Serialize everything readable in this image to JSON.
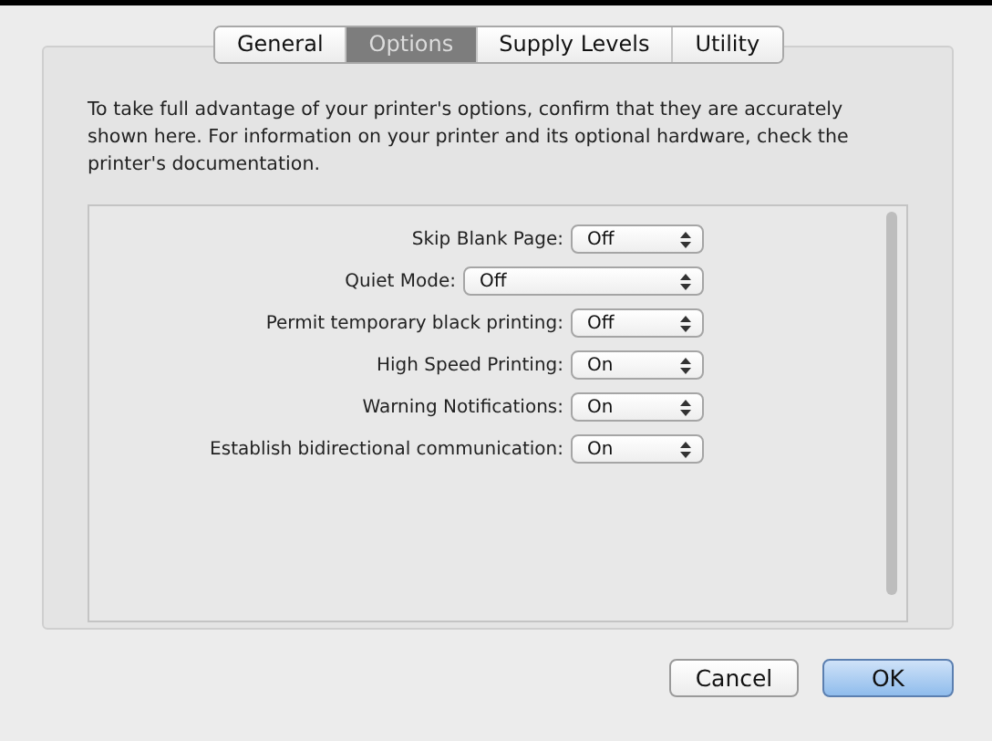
{
  "tabs": [
    {
      "label": "General",
      "selected": false
    },
    {
      "label": "Options",
      "selected": true
    },
    {
      "label": "Supply Levels",
      "selected": false
    },
    {
      "label": "Utility",
      "selected": false
    }
  ],
  "description": "To take full advantage of your printer's options, confirm that they are accurately shown here. For information on your printer and its optional hardware, check the printer's documentation.",
  "options": [
    {
      "label": "Skip Blank Page:",
      "value": "Off",
      "kind": "narrow"
    },
    {
      "label": "Quiet Mode:",
      "value": "Off",
      "kind": "wide"
    },
    {
      "label": "Permit temporary black printing:",
      "value": "Off",
      "kind": "narrow"
    },
    {
      "label": "High Speed Printing:",
      "value": "On",
      "kind": "narrow"
    },
    {
      "label": "Warning Notifications:",
      "value": "On",
      "kind": "narrow"
    },
    {
      "label": "Establish bidirectional communication:",
      "value": "On",
      "kind": "narrow"
    }
  ],
  "buttons": [
    {
      "label": "Cancel",
      "default": false
    },
    {
      "label": "OK",
      "default": true
    }
  ]
}
